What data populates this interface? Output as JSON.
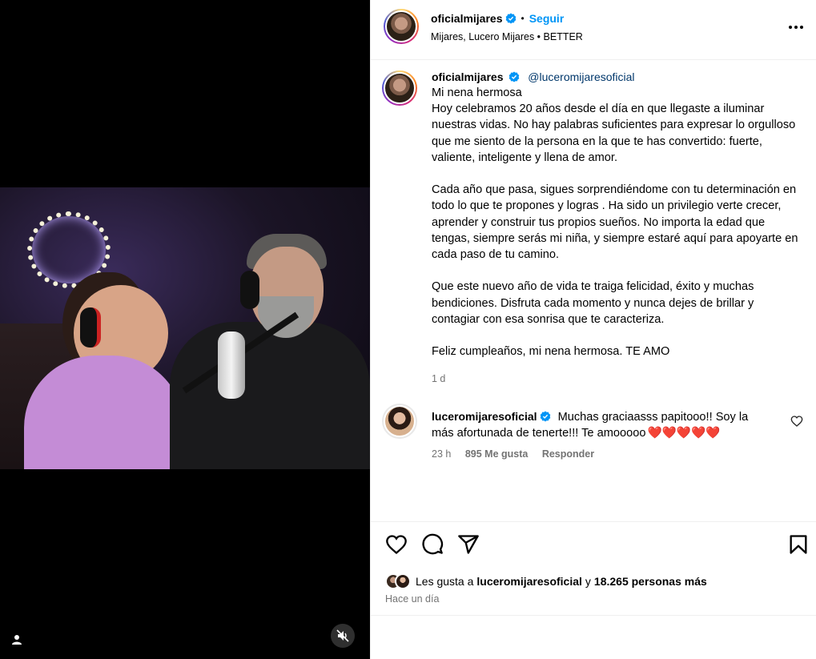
{
  "post": {
    "author": "oficialmijares",
    "follow_label": "Seguir",
    "separator": "•",
    "audio_line": "Mijares, Lucero Mijares • BETTER"
  },
  "caption": {
    "author": "oficialmijares",
    "mention": "@luceromijaresoficial",
    "text": "Mi nena hermosa\nHoy celebramos 20 años desde el día en que llegaste a iluminar nuestras vidas. No hay palabras suficientes para expresar lo orgulloso que me siento de la persona en la que te has convertido: fuerte, valiente, inteligente y llena de amor.\n\nCada año que pasa, sigues sorprendiéndome con tu determinación en todo lo que te propones y logras . Ha sido un privilegio verte crecer, aprender y construir tus propios sueños. No importa la edad que tengas, siempre serás mi niña, y siempre estaré aquí para apoyarte en cada paso de tu camino.\n\nQue este nuevo año de vida te traiga felicidad, éxito y muchas bendiciones. Disfruta cada momento y nunca dejes de brillar y contagiar con esa sonrisa que te caracteriza.\n\nFeliz cumpleaños, mi nena hermosa. TE AMO",
    "time": "1 d"
  },
  "reply": {
    "author": "luceromijaresoficial",
    "text": "Muchas graciaasss papitooo!! Soy la más afortunada de tenerte!!! Te amooooo",
    "hearts": "❤️❤️❤️❤️❤️",
    "time": "23 h",
    "likes": "895 Me gusta",
    "reply_label": "Responder"
  },
  "likes": {
    "prefix": "Les gusta a",
    "user": "luceromijaresoficial",
    "connector": "y",
    "others": "18.265 personas más"
  },
  "post_time": "Hace un día",
  "colors": {
    "link_blue": "#0095f6",
    "verified_blue": "#0095f6",
    "mention": "#00376b",
    "muted": "#737373",
    "heart_red": "#ff3040"
  },
  "icons": [
    "user-tag-icon",
    "mute-icon",
    "verified-icon",
    "more-icon",
    "heart-icon",
    "comment-icon",
    "share-icon",
    "bookmark-icon"
  ]
}
